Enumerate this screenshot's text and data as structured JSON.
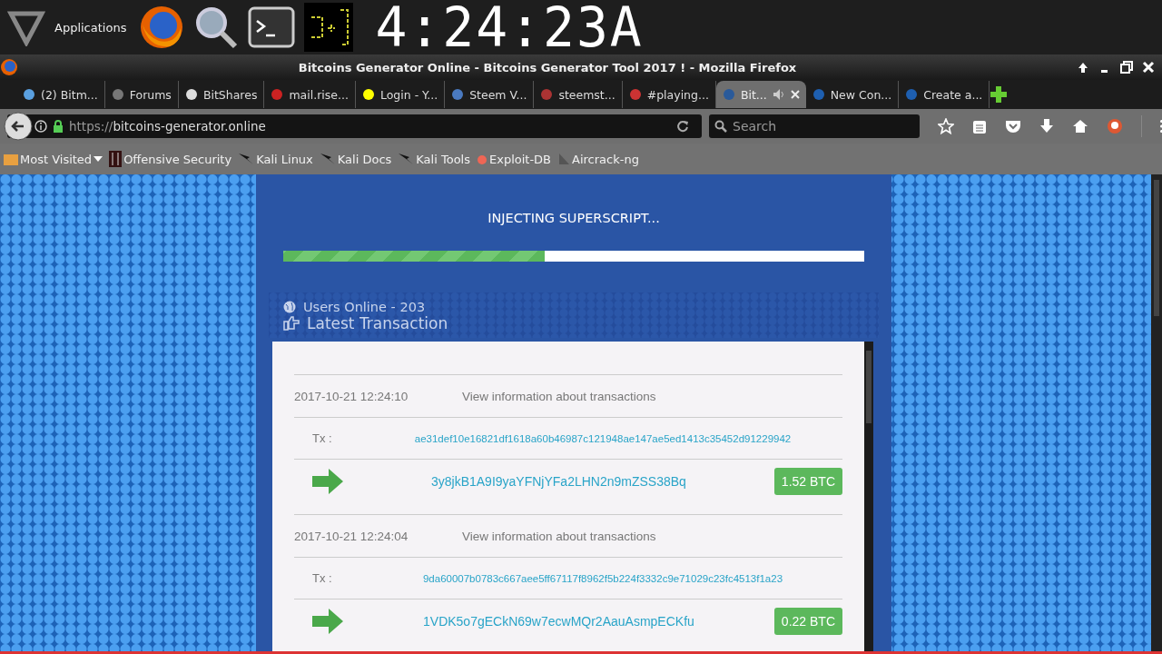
{
  "panel": {
    "menu_label": "Applications",
    "clock": "4:24:23A"
  },
  "window": {
    "title": "Bitcoins Generator Online - Bitcoins Generator Tool 2017 ! - Mozilla Firefox"
  },
  "tabs": [
    {
      "label": "(2) Bitm...",
      "selected": false
    },
    {
      "label": "Forums",
      "selected": false
    },
    {
      "label": "BitShares",
      "selected": false
    },
    {
      "label": "mail.rise...",
      "selected": false
    },
    {
      "label": "Login - Y...",
      "selected": false
    },
    {
      "label": "Steem V...",
      "selected": false
    },
    {
      "label": "steemst...",
      "selected": false
    },
    {
      "label": "#playing...",
      "selected": false
    },
    {
      "label": "Bit...",
      "selected": true
    },
    {
      "label": "New Con...",
      "selected": false
    },
    {
      "label": "Create a...",
      "selected": false
    }
  ],
  "navbar": {
    "url_scheme": "https://",
    "url_host": "bitcoins-generator.online",
    "search_placeholder": "Search"
  },
  "bookmarks": [
    "Most Visited",
    "Offensive Security",
    "Kali Linux",
    "Kali Docs",
    "Kali Tools",
    "Exploit-DB",
    "Aircrack-ng"
  ],
  "page": {
    "status": "INJECTING SUPERSCRIPT...",
    "progress": {
      "level": 0.45
    },
    "users_online": "Users Online - 203",
    "latest_heading": "Latest Transaction",
    "transactions": [
      {
        "time": "2017-10-21 12:24:10",
        "info": "View information about transactions",
        "tx_label": "Tx :",
        "tx_hash": "ae31def10e16821df1618a60b46987c121948ae147ae5ed1413c35452d91229942",
        "address": "3y8jkB1A9I9yaYFNjYFa2LHN2n9mZSS38Bq",
        "amount": "1.52 BTC"
      },
      {
        "time": "2017-10-21 12:24:04",
        "info": "View information about transactions",
        "tx_label": "Tx :",
        "tx_hash": "9da60007b0783c667aee5ff67117f8962f5b224f3332c9e71029c23fc4513f1a23",
        "address": "1VDK5o7gECkN69w7ecwMQr2AauAsmpECKfu",
        "amount": "0.22 BTC"
      }
    ]
  }
}
